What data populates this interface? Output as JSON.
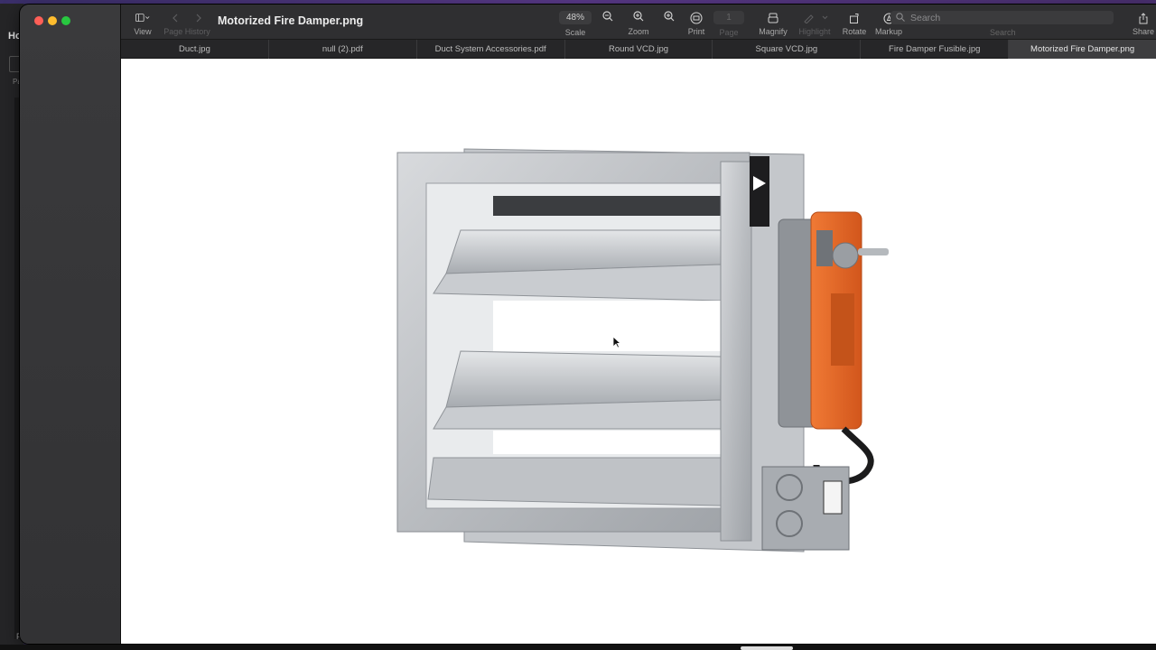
{
  "background_app": {
    "title_fragment": "Ho",
    "label_fragment": "Pa",
    "bottom_fragment": "F"
  },
  "window": {
    "title": "Motorized Fire Damper.png"
  },
  "toolbar": {
    "view_label": "View",
    "page_history_label": "Page History",
    "scale_value": "48%",
    "scale_label": "Scale",
    "zoom_label": "Zoom",
    "print_label": "Print",
    "page_value": "1",
    "page_label": "Page",
    "magnify_label": "Magnify",
    "highlight_label": "Highlight",
    "rotate_label": "Rotate",
    "markup_label": "Markup",
    "search_placeholder": "Search",
    "search_label": "Search",
    "share_label": "Share"
  },
  "tabs": [
    {
      "label": "Duct.jpg",
      "active": false
    },
    {
      "label": "null (2).pdf",
      "active": false
    },
    {
      "label": "Duct System Accessories.pdf",
      "active": false
    },
    {
      "label": "Round VCD.jpg",
      "active": false
    },
    {
      "label": "Square VCD.jpg",
      "active": false
    },
    {
      "label": "Fire Damper Fusible.jpg",
      "active": false
    },
    {
      "label": "Motorized Fire Damper.png",
      "active": true
    }
  ],
  "colors": {
    "actuator": "#e8692a",
    "traffic_close": "#ff5f57",
    "traffic_min": "#febc2e",
    "traffic_max": "#28c840"
  }
}
